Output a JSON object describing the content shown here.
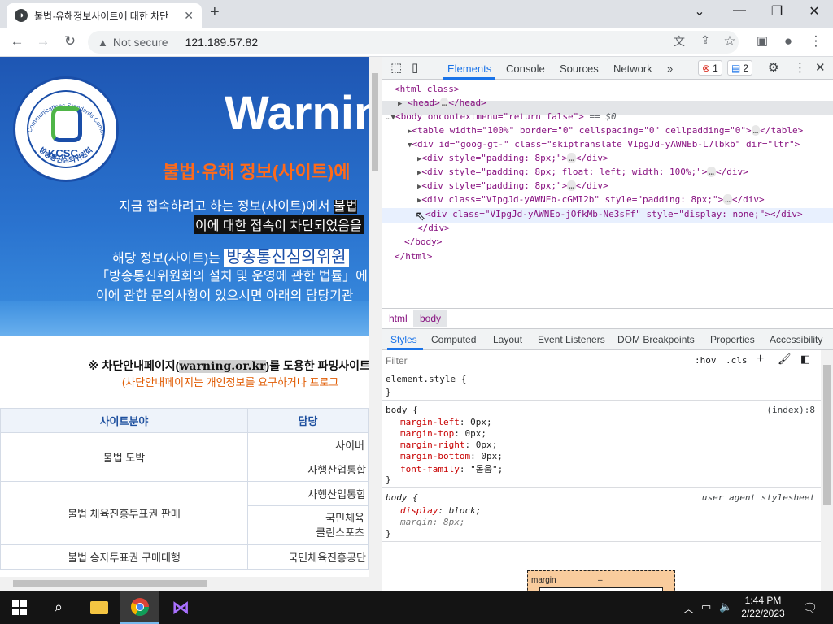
{
  "browser": {
    "tab_title": "불법·유해정보사이트에 대한 차단",
    "favicon_glyph": "◑",
    "tab_close": "✕",
    "new_tab": "+",
    "security_label": "Not secure",
    "url": "121.189.57.82",
    "window_controls": {
      "minimize": "⌄",
      "minimize2": "—",
      "restore": "❐",
      "close": "✕"
    }
  },
  "page": {
    "warning_title": "Warning",
    "headline": "불법·유해 정보(사이트)에",
    "line1_a": "지금 접속하려고 하는 정보(사이트)에서 ",
    "line1_b": "불법",
    "line2": "이에 대한 접속이 차단되었음을",
    "line3_a": "해당 정보(사이트)는 ",
    "line3_b": "방송통신심의위원",
    "line4": "「방송통신위원회의 설치 및 운영에 관한 법률」에",
    "line5": "이에 관한 문의사항이 있으시면 아래의 담당기관",
    "seal_text": "KCSC",
    "seal_ring_top": "Korea Communications Standards Commission",
    "seal_ring_bottom": "방송통신심의위원회",
    "notice_prefix": "※ 차단안내페이지(",
    "notice_site": "warning.or.kr",
    "notice_suffix": ")를 도용한 파밍사이트",
    "notice_sub": "(차단안내페이지는 개인정보를 요구하거나 프로그",
    "table": {
      "headers": [
        "사이트분야",
        "담당"
      ],
      "rows": [
        [
          "불법 도박",
          "사이버"
        ],
        [
          "",
          "사행산업통합"
        ],
        [
          "불법 체육진흥투표권 판매",
          "사행산업통합"
        ],
        [
          "",
          "국민체육"
        ],
        [
          "",
          "클린스포츠"
        ],
        [
          "불법 승자투표권 구매대행",
          "국민체육진흥공단"
        ]
      ]
    }
  },
  "devtools": {
    "tabs": [
      "Elements",
      "Console",
      "Sources",
      "Network",
      "»"
    ],
    "errors": "1",
    "messages": "2",
    "dom": {
      "html_open": "<html class>",
      "head": "<head>",
      "head_close": "</head>",
      "body_tag": "<body oncontextmenu=\"return false\">",
      "body_eq": "== $0",
      "table_line": "<table width=\"100%\" border=\"0\" cellspacing=\"0\" cellpadding=\"0\">",
      "table_close": "</table>",
      "div_goog": "<div id=\"goog-gt-\" class=\"skiptranslate VIpgJd-yAWNEb-L7lbkb\" dir=\"ltr\">",
      "div1": "<div style=\"padding: 8px;\">",
      "div2": "<div style=\"padding: 8px; float: left; width: 100%;\">",
      "div3": "<div style=\"padding: 8px;\">",
      "div4": "<div class=\"VIpgJd-yAWNEb-cGMI2b\" style=\"padding: 8px;\">",
      "div5": "<div class=\"VIpgJd-yAWNEb-jOfkMb-Ne3sFf\" style=\"display: none;\"></div>",
      "div_close": "</div>",
      "body_close": "</body>",
      "html_close": "</html>",
      "ellipsis": "…"
    },
    "breadcrumbs": [
      "html",
      "body"
    ],
    "styles_tabs": [
      "Styles",
      "Computed",
      "Layout",
      "Event Listeners",
      "DOM Breakpoints",
      "Properties",
      "Accessibility"
    ],
    "filter_placeholder": "Filter",
    "hov": ":hov",
    "cls": ".cls",
    "rules": {
      "element_style": "element.style {",
      "close": "}",
      "body_sel": "body {",
      "source": "(index):8",
      "props": [
        {
          "n": "margin-left",
          "v": "0px;"
        },
        {
          "n": "margin-top",
          "v": "0px;"
        },
        {
          "n": "margin-right",
          "v": "0px;"
        },
        {
          "n": "margin-bottom",
          "v": "0px;"
        },
        {
          "n": "font-family",
          "v": "\"돋움\";"
        }
      ],
      "ua_sel": "body {",
      "ua_label": "user agent stylesheet",
      "ua_display_n": "display",
      "ua_display_v": "block;",
      "ua_margin": "margin: 8px;"
    },
    "box_label": "margin",
    "box_dash": "–"
  },
  "taskbar": {
    "time": "1:44 PM",
    "date": "2/22/2023"
  },
  "colors": {
    "accent": "#1a73e8",
    "banner": "#1e56b3",
    "headline": "#ff6a1a"
  }
}
